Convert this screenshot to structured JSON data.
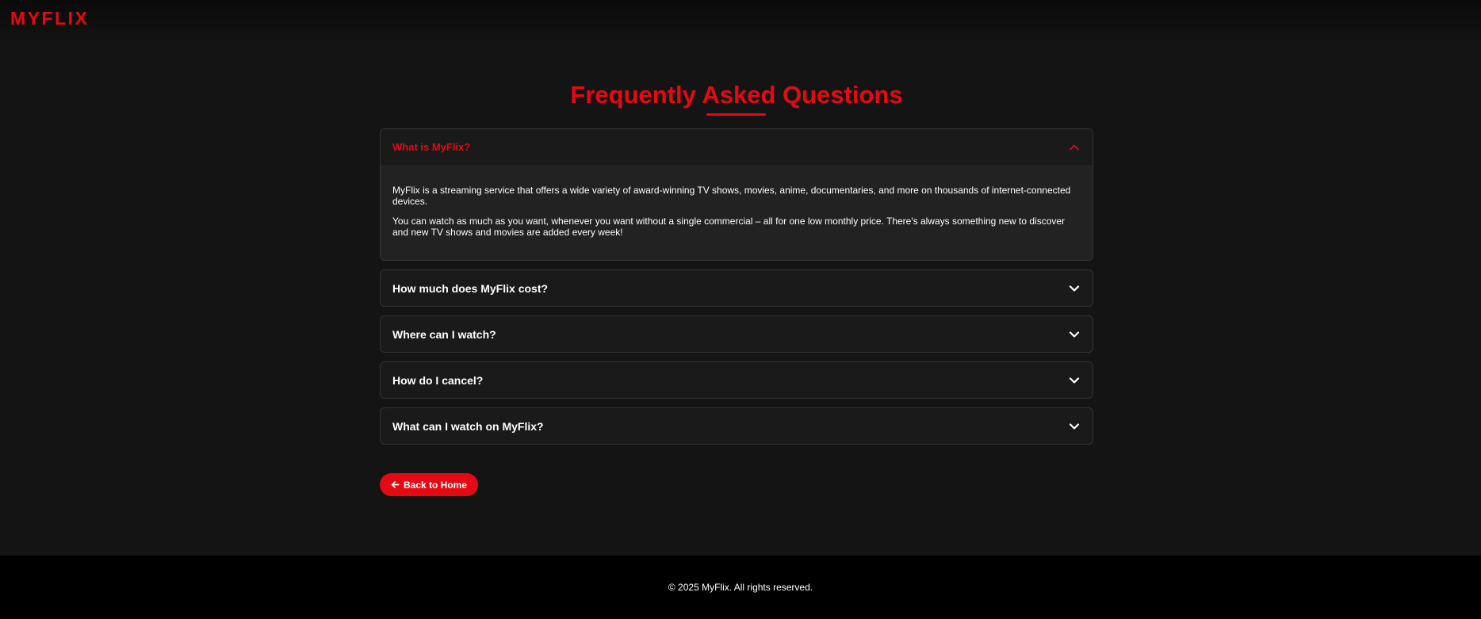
{
  "brand": {
    "logo_text": "MYFLIX",
    "accent_color": "#e50914"
  },
  "page": {
    "title": "Frequently Asked Questions"
  },
  "faq": [
    {
      "question": "What is MyFlix?",
      "open": true,
      "icon": "chevron-up-icon",
      "answer": [
        "MyFlix is a streaming service that offers a wide variety of award-winning TV shows, movies, anime, documentaries, and more on thousands of internet-connected devices.",
        "You can watch as much as you want, whenever you want without a single commercial – all for one low monthly price. There's always something new to discover and new TV shows and movies are added every week!"
      ]
    },
    {
      "question": "How much does MyFlix cost?",
      "open": false,
      "icon": "chevron-down-icon"
    },
    {
      "question": "Where can I watch?",
      "open": false,
      "icon": "chevron-down-icon"
    },
    {
      "question": "How do I cancel?",
      "open": false,
      "icon": "chevron-down-icon"
    },
    {
      "question": "What can I watch on MyFlix?",
      "open": false,
      "icon": "chevron-down-icon"
    }
  ],
  "back_button": {
    "label": "Back to Home",
    "icon": "arrow-left-icon"
  },
  "footer": {
    "copyright": "© 2025 MyFlix. All rights reserved."
  }
}
